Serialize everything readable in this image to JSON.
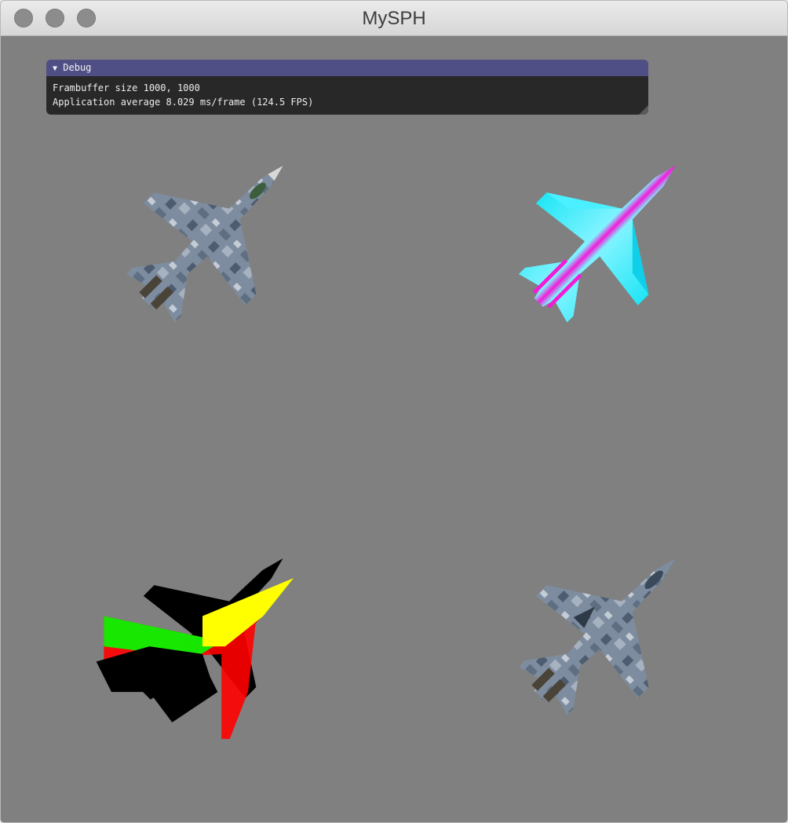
{
  "window": {
    "title": "MySPH"
  },
  "debug_panel": {
    "header": "Debug",
    "line1": "Frambuffer size 1000, 1000",
    "line2": "Application average 8.029 ms/frame (124.5 FPS)"
  },
  "colors": {
    "background": "#808080",
    "panel_header": "#4f4f86",
    "panel_body": "#282828",
    "normals_cyan": "#22e6f6",
    "normals_magenta": "#f21cd8",
    "uv_green": "#00ff00",
    "uv_yellow": "#ffff00",
    "uv_red": "#ff0000"
  },
  "icons": {
    "collapse": "triangle-down-icon"
  }
}
